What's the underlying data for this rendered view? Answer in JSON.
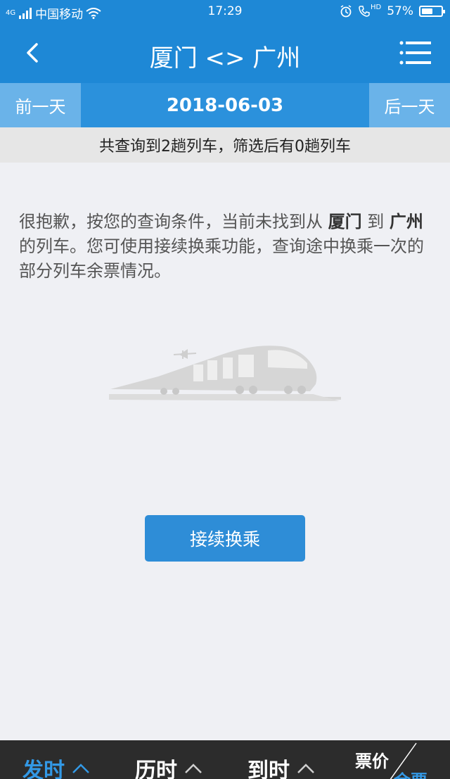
{
  "status_bar": {
    "network": "4G",
    "carrier": "中国移动",
    "time": "17:29",
    "hd_label": "HD",
    "battery_percent": "57%",
    "battery_level": 0.57
  },
  "nav": {
    "title": "厦门 <> 广州",
    "back_icon": "chevron-left-icon",
    "menu_icon": "menu-list-icon"
  },
  "date_bar": {
    "prev_label": "前一天",
    "date": "2018-06-03",
    "next_label": "后一天"
  },
  "summary": "共查询到2趟列车，筛选后有0趟列车",
  "message": {
    "part1": "很抱歉，按您的查询条件，当前未找到从 ",
    "from": "厦门",
    "part2": " 到 ",
    "to": "广州",
    "part3": " 的列车。您可使用接续换乘功能，查询途中换乘一次的部分列车余票情况。"
  },
  "transfer_button": "接续换乘",
  "bottom_sort": {
    "depart": "发时",
    "duration": "历时",
    "arrive": "到时",
    "price": "票价",
    "tickets": "余票"
  },
  "colors": {
    "primary": "#1e88d6",
    "accent": "#3399e6",
    "bottom_bg": "#2c2c2c"
  }
}
